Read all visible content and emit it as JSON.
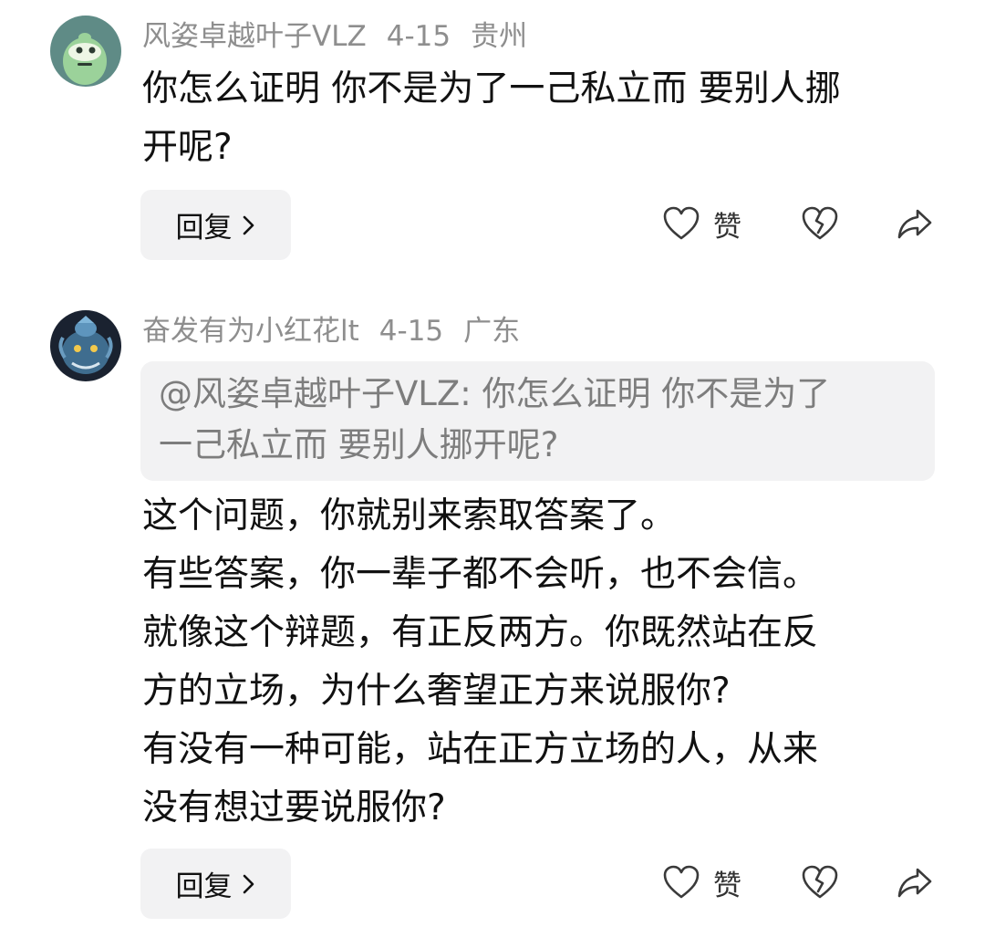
{
  "comments": [
    {
      "username": "风姿卓越叶子VLZ",
      "date": "4-15",
      "location": "贵州",
      "content_lines": [
        "你怎么证明 你不是为了一己私立而 要别人挪",
        "开呢?"
      ],
      "reply_label": "回复",
      "like_label": "赞",
      "avatar_icon": "green-cartoon-avatar-icon"
    },
    {
      "username": "奋发有为小红花lt",
      "date": "4-15",
      "location": "广东",
      "quote_lines": [
        "@风姿卓越叶子VLZ: 你怎么证明 你不是为了",
        "一己私立而 要别人挪开呢?"
      ],
      "content_lines": [
        "这个问题，你就别来索取答案了。",
        "有些答案，你一辈子都不会听，也不会信。",
        "就像这个辩题，有正反两方。你既然站在反",
        "方的立场，为什么奢望正方来说服你?",
        "有没有一种可能，站在正方立场的人，从来",
        "没有想过要说服你?"
      ],
      "reply_label": "回复",
      "like_label": "赞",
      "avatar_icon": "blue-dragon-avatar-icon"
    }
  ],
  "colors": {
    "meta_text": "#8e8e8e",
    "body_text": "#111111",
    "quote_background": "#f2f2f3",
    "quote_text": "#7d7d7d",
    "icon_stroke": "#3a3a3a"
  }
}
